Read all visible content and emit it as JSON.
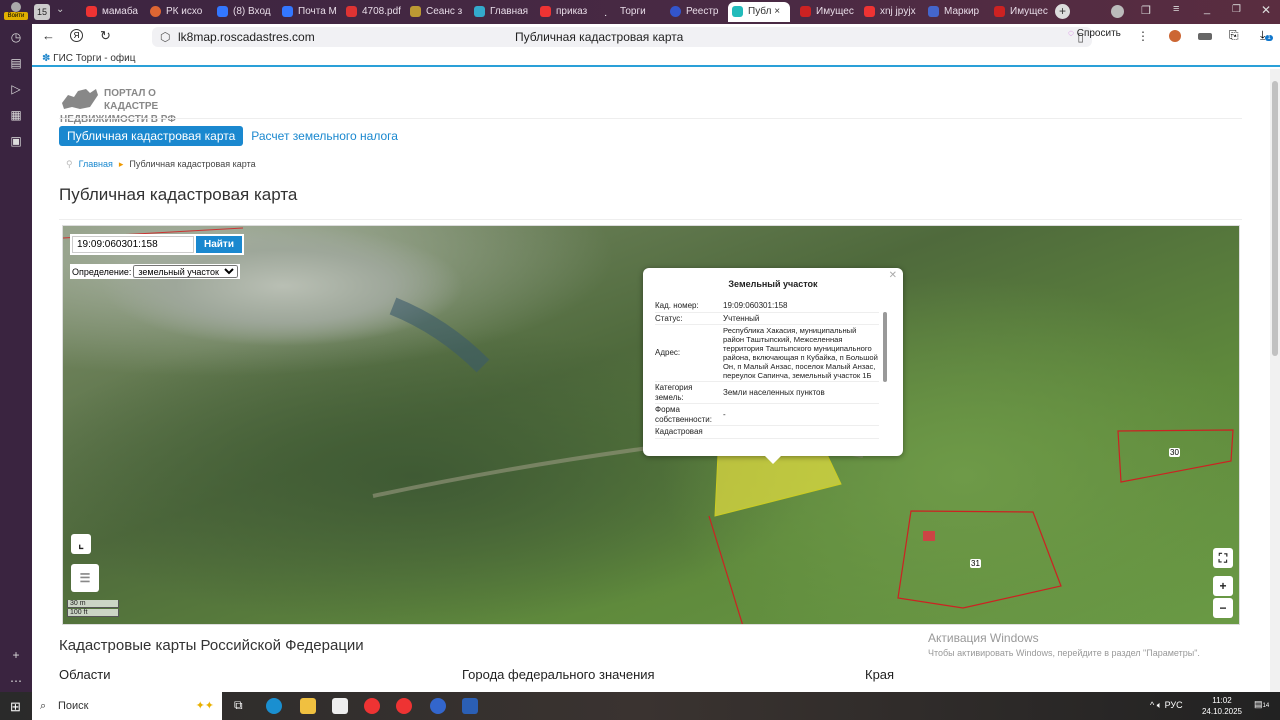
{
  "browser": {
    "tabs": [
      {
        "label": "мамаба"
      },
      {
        "label": "РК исхо"
      },
      {
        "label": "(8) Вход"
      },
      {
        "label": "Почта М"
      },
      {
        "label": "4708.pdf"
      },
      {
        "label": "Сеанс з"
      },
      {
        "label": "Главная"
      },
      {
        "label": "приказ"
      },
      {
        "label": "Торги"
      },
      {
        "label": "Реестр"
      },
      {
        "label": "Публ"
      },
      {
        "label": "Имущес"
      },
      {
        "label": "xnj jpyjx"
      },
      {
        "label": "Маркир"
      },
      {
        "label": "Имущес"
      }
    ],
    "tab_count": "15",
    "login_label": "Войти",
    "url": "lk8map.roscadastres.com",
    "page_title": "Публичная кадастровая карта",
    "ask_label": "Спросить",
    "bookmark": "ГИС Торги - офиц",
    "download_badge": "1"
  },
  "site": {
    "logo_line1": "ПОРТАЛ О КАДАСТРЕ",
    "logo_line2": "НЕДВИЖИМОСТИ В РФ",
    "nav": [
      "Публичная кадастровая карта",
      "Расчет земельного налога"
    ],
    "breadcrumb": {
      "home": "Главная",
      "current": "Публичная кадастровая карта"
    },
    "title": "Публичная кадастровая карта"
  },
  "map": {
    "search_value": "19:09:060301:158",
    "search_button": "Найти",
    "definition_label": "Определение:",
    "definition_value": "земельный участок",
    "scale_m": "30 m",
    "scale_ft": "100 ft",
    "zoom_in": "+",
    "zoom_out": "−",
    "parcel_labels": [
      "30",
      "31"
    ],
    "popup": {
      "title": "Земельный участок",
      "rows": [
        {
          "k": "Кад. номер:",
          "v": "19:09:060301:158"
        },
        {
          "k": "Статус:",
          "v": "Учтенный"
        },
        {
          "k": "Адрес:",
          "v": "Республика Хакасия, муниципальный район Таштыпский, Межселенная территория Таштыпского муниципального района, включающая п Кубайка, п Большой Он, п Малый Анзас, поселок Малый Анзас, переулок Сапинча, земельный участок 1Б"
        },
        {
          "k": "Категория земель:",
          "v": "Земли населенных пунктов"
        },
        {
          "k": "Форма собственности:",
          "v": "-"
        },
        {
          "k": "Кадастровая",
          "v": ""
        }
      ]
    }
  },
  "section": {
    "title": "Кадастровые карты Российской Федерации",
    "cols": [
      "Области",
      "Города федерального значения",
      "Края"
    ]
  },
  "watermark": {
    "title": "Активация Windows",
    "text": "Чтобы активировать Windows, перейдите в раздел \"Параметры\"."
  },
  "taskbar": {
    "search": "Поиск",
    "lang": "РУС",
    "time": "11:02",
    "date": "24.10.2025",
    "notif": "14"
  }
}
